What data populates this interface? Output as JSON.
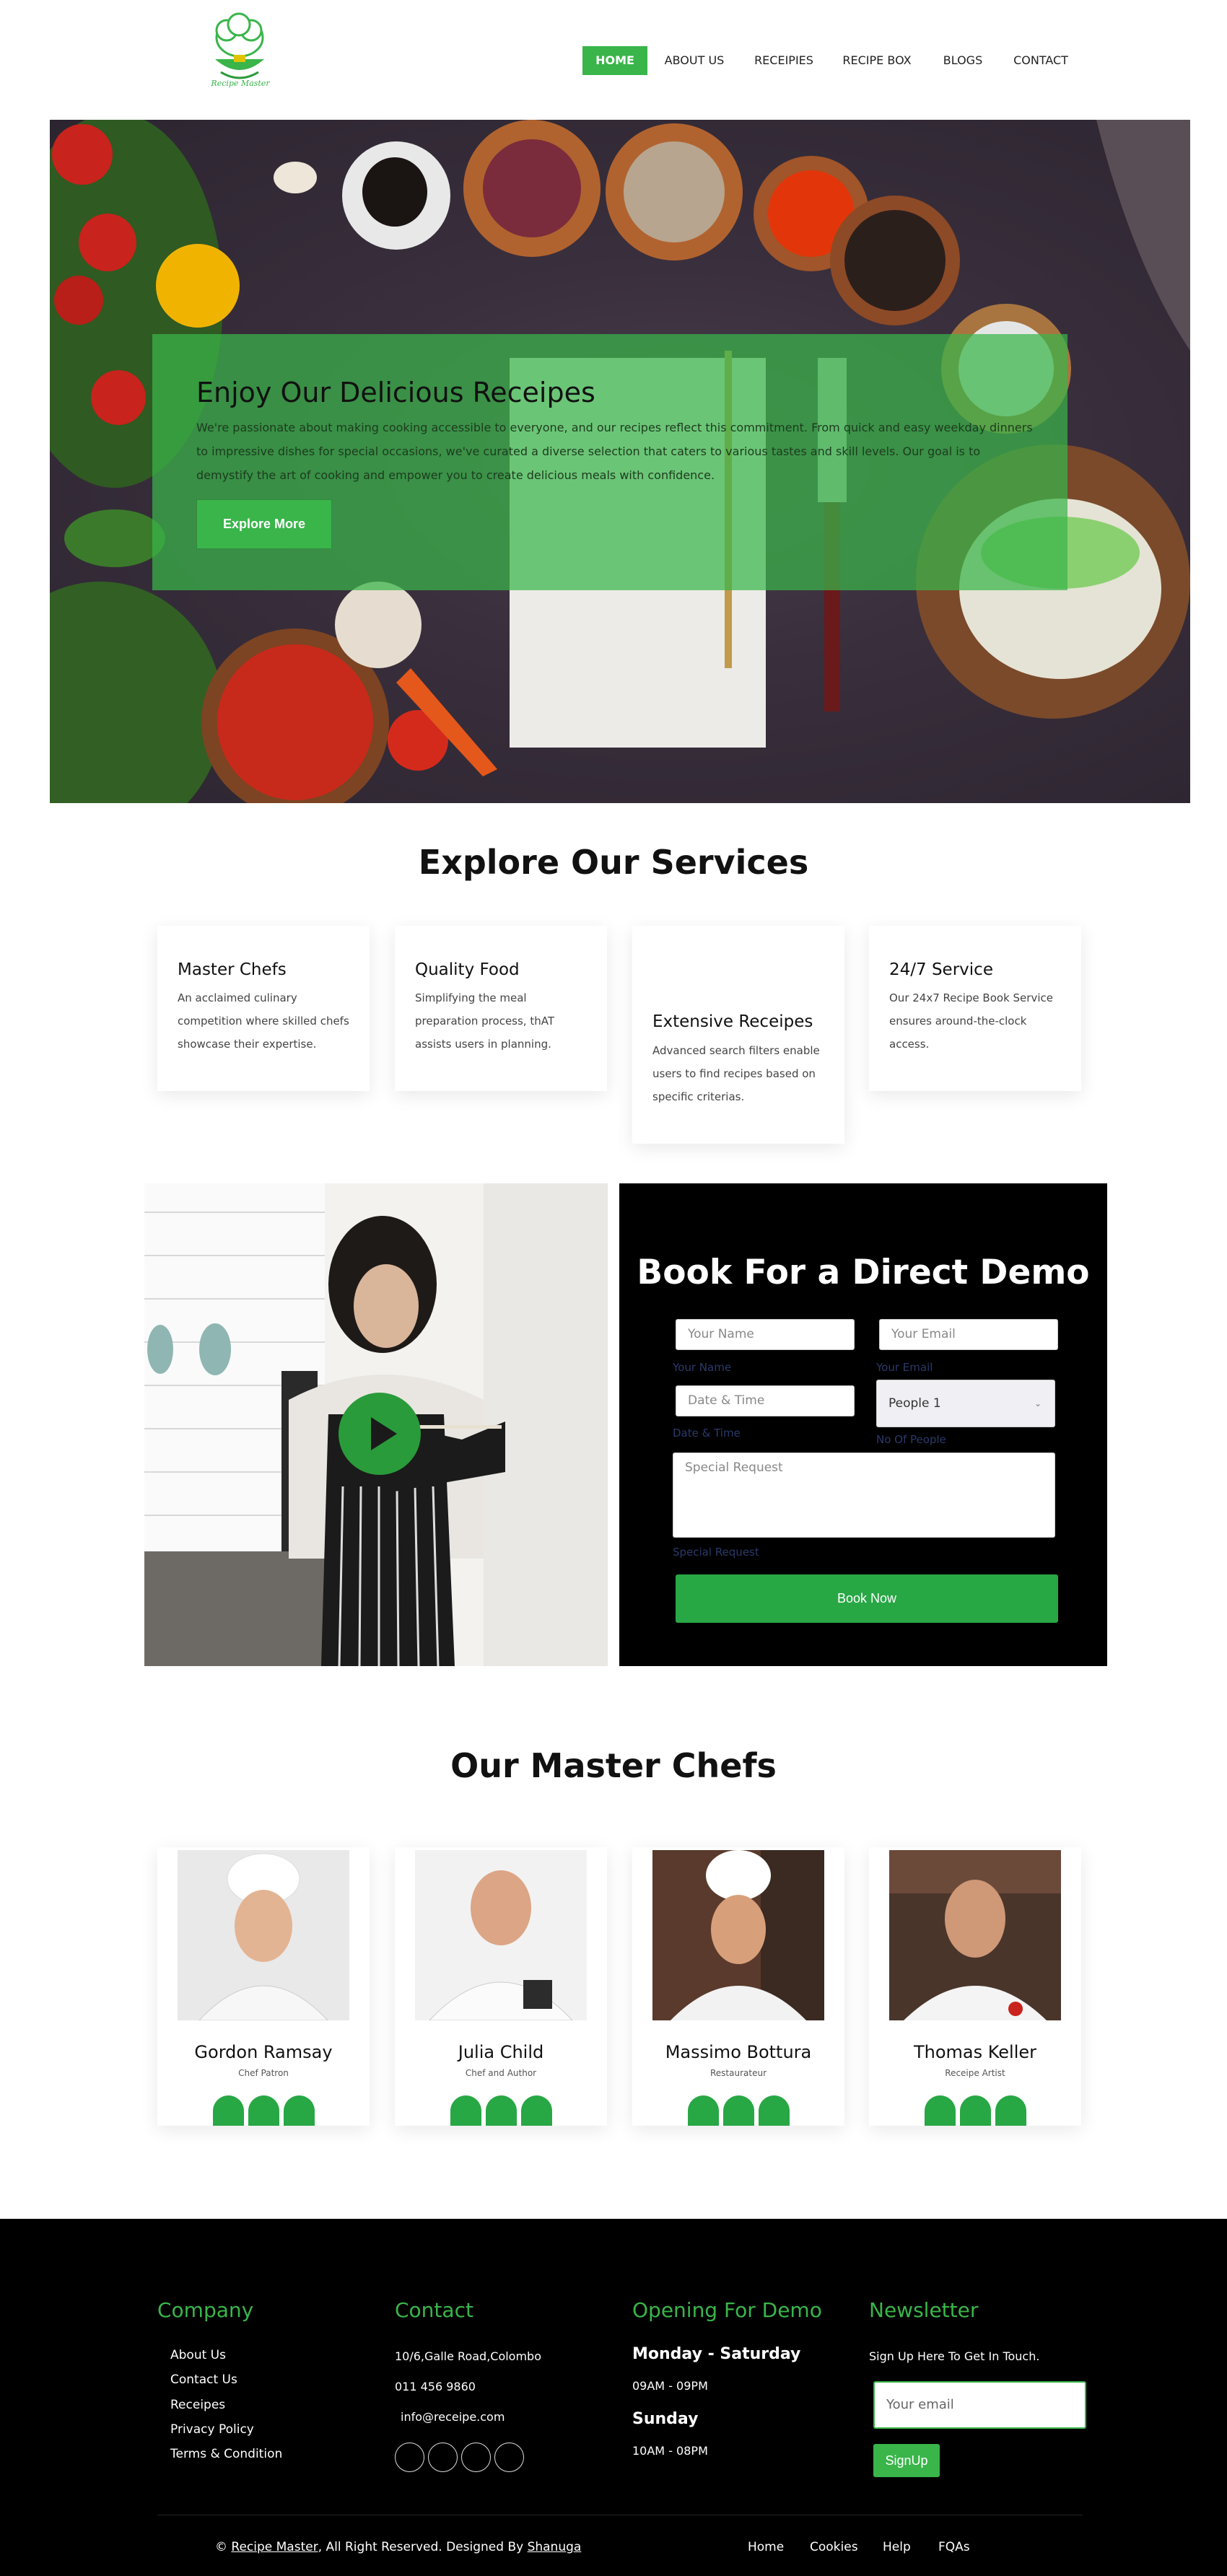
{
  "nav": {
    "logo_text": "Recipe Master",
    "items": [
      "HOME",
      "ABOUT US",
      "RECEIPIES",
      "RECIPE BOX",
      "BLOGS",
      "CONTACT"
    ]
  },
  "hero": {
    "title": "Enjoy Our Delicious Receipes",
    "text": "We're passionate about making cooking accessible to everyone, and our recipes reflect this commitment. From quick and easy weekday dinners to impressive dishes for special occasions, we've curated a diverse selection that caters to various tastes and skill levels. Our goal is to demystify the art of cooking and empower you to create delicious meals with confidence.",
    "button": "Explore More"
  },
  "services": {
    "title": "Explore Our Services",
    "cards": [
      {
        "title": "Master Chefs",
        "desc": "An acclaimed culinary competition where skilled chefs showcase their expertise."
      },
      {
        "title": "Quality Food",
        "desc": "Simplifying the meal preparation process, thAT assists users in planning."
      },
      {
        "title": "Extensive Receipes",
        "desc": "Advanced search filters enable users to find recipes based on specific criterias."
      },
      {
        "title": "24/7 Service",
        "desc": "Our 24x7 Recipe Book Service ensures around-the-clock access."
      }
    ]
  },
  "demo": {
    "title": "Book For a Direct Demo",
    "name_placeholder": "Your Name",
    "name_label": "Your Name",
    "email_placeholder": "Your Email",
    "email_label": "Your Email",
    "date_placeholder": "Date & Time",
    "date_label": "Date & Time",
    "people_value": "People 1",
    "people_label": "No Of People",
    "request_placeholder": "Special Request",
    "request_label": "Special Request",
    "button": "Book Now"
  },
  "chefs": {
    "title": "Our Master Chefs",
    "items": [
      {
        "name": "Gordon Ramsay",
        "role": "Chef Patron"
      },
      {
        "name": "Julia Child",
        "role": "Chef and Author"
      },
      {
        "name": "Massimo Bottura",
        "role": "Restaurateur"
      },
      {
        "name": "Thomas Keller",
        "role": "Receipe Artist"
      }
    ]
  },
  "footer": {
    "company_title": "Company",
    "company_links": [
      "About Us",
      "Contact Us",
      "Receipes",
      "Privacy Policy",
      "Terms & Condition"
    ],
    "contact_title": "Contact",
    "address": "10/6,Galle Road,Colombo",
    "phone": "011 456 9860",
    "email": "info@receipe.com",
    "hours_title": "Opening For Demo",
    "weekday_label": "Monday - Saturday",
    "weekday_hours": "09AM - 09PM",
    "sunday_label": "Sunday",
    "sunday_hours": "10AM - 08PM",
    "newsletter_title": "Newsletter",
    "newsletter_text": "Sign Up Here To Get In Touch.",
    "newsletter_placeholder": "Your email",
    "newsletter_button": "SignUp",
    "copyright_prefix": "©",
    "copyright_brand": "Recipe Master",
    "copyright_mid": ", All Right Reserved. Designed By",
    "copyright_designer": "Shanuga",
    "bottom_links": [
      "Home",
      "Cookies",
      "Help",
      "FQAs"
    ]
  },
  "colors": {
    "accent": "#39b54a",
    "button_green": "#28a745",
    "dark": "#000000"
  }
}
